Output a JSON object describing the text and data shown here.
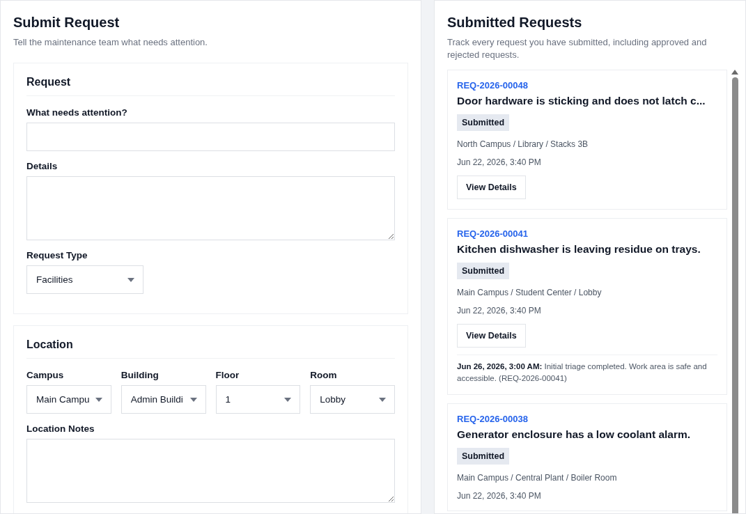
{
  "form": {
    "title": "Submit Request",
    "subtitle": "Tell the maintenance team what needs attention.",
    "sections": [
      {
        "title": "Request",
        "fields": [
          {
            "kind": "input",
            "label": "What needs attention?"
          },
          {
            "kind": "textarea",
            "label": "Details"
          },
          {
            "kind": "select",
            "label": "Request Type",
            "value": "Facilities"
          }
        ]
      },
      {
        "title": "Location",
        "fields": [
          {
            "kind": "select_row",
            "selects": [
              {
                "label": "Campus",
                "value": "Main Campu"
              },
              {
                "label": "Building",
                "value": "Admin Buildi"
              },
              {
                "label": "Floor",
                "value": "1"
              },
              {
                "label": "Room",
                "value": "Lobby"
              }
            ]
          },
          {
            "kind": "textarea",
            "label": "Location Notes"
          }
        ]
      }
    ]
  },
  "requests": {
    "title": "Submitted Requests",
    "subtitle": "Track every request you have submitted, including approved and rejected requests.",
    "items": [
      {
        "id": "REQ-2026-00048",
        "title": "Door hardware is sticking and does not latch c...",
        "status": "Submitted",
        "location": "North Campus / Library / Stacks 3B",
        "date": "Jun 22, 2026, 3:40 PM",
        "button": "View Details"
      },
      {
        "id": "REQ-2026-00041",
        "title": "Kitchen dishwasher is leaving residue on trays.",
        "status": "Submitted",
        "location": "Main Campus / Student Center / Lobby",
        "date": "Jun 22, 2026, 3:40 PM",
        "button": "View Details",
        "note": "**Jun 26, 2026, 3:00 AM:** Initial triage completed. Work area is safe and accessible. (REQ-2026-00041)"
      },
      {
        "id": "REQ-2026-00038",
        "title": "Generator enclosure has a low coolant alarm.",
        "status": "Submitted",
        "location": "Main Campus / Central Plant / Boiler Room",
        "date": "Jun 22, 2026, 3:40 PM"
      }
    ]
  }
}
